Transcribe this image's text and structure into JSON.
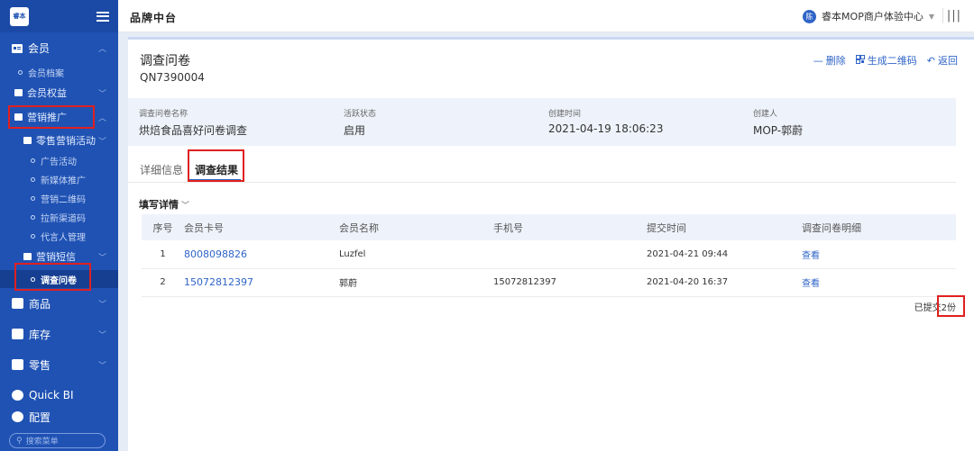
{
  "sidebar": {
    "logo_text": "睿本",
    "items": {
      "member": "会员",
      "member_archive": "会员档案",
      "member_rights": "会员权益",
      "marketing": "营销推广",
      "retail_marketing": "零售营销活动",
      "ad_campaign": "广告活动",
      "new_media": "新媒体推广",
      "marketing_qr": "营销二维码",
      "new_channel_code": "拉新渠道码",
      "agent_manage": "代言人管理",
      "marketing_sms": "营销短信",
      "survey": "调查问卷",
      "goods": "商品",
      "inventory": "库存",
      "retail": "零售",
      "quick_bi": "Quick BI",
      "config": "配置"
    },
    "search_placeholder": "搜索菜单"
  },
  "header": {
    "brand": "品牌中台",
    "user_avatar": "陈",
    "user_name": "睿本MOP商户体验中心",
    "menu_glyph": "|||"
  },
  "page": {
    "title": "调查问卷",
    "code": "QN7390004",
    "actions": {
      "delete": "删除",
      "qr": "生成二维码",
      "back": "返回"
    }
  },
  "info": {
    "name_label": "调查问卷名称",
    "name_value": "烘焙食品喜好问卷调查",
    "status_label": "活跃状态",
    "status_value": "启用",
    "created_label": "创建时间",
    "created_value": "2021-04-19 18:06:23",
    "creator_label": "创建人",
    "creator_value": "MOP-郭蔚"
  },
  "tabs": {
    "detail": "详细信息",
    "result": "调查结果"
  },
  "fill_details": "填写详情",
  "table": {
    "headers": {
      "idx": "序号",
      "card": "会员卡号",
      "name": "会员名称",
      "phone": "手机号",
      "time": "提交时间",
      "detail": "调查问卷明细"
    },
    "rows": [
      {
        "idx": "1",
        "card": "8008098826",
        "name": "Luzfel",
        "phone": "",
        "time": "2021-04-21 09:44",
        "detail": "查看"
      },
      {
        "idx": "2",
        "card": "15072812397",
        "name": "郭蔚",
        "phone": "15072812397",
        "time": "2021-04-20 16:37",
        "detail": "查看"
      }
    ]
  },
  "total_text": "已提交2份",
  "colors": {
    "sidebar": "#1f52b3",
    "accent": "#2f64c7",
    "highlight_box": "#e02020"
  }
}
